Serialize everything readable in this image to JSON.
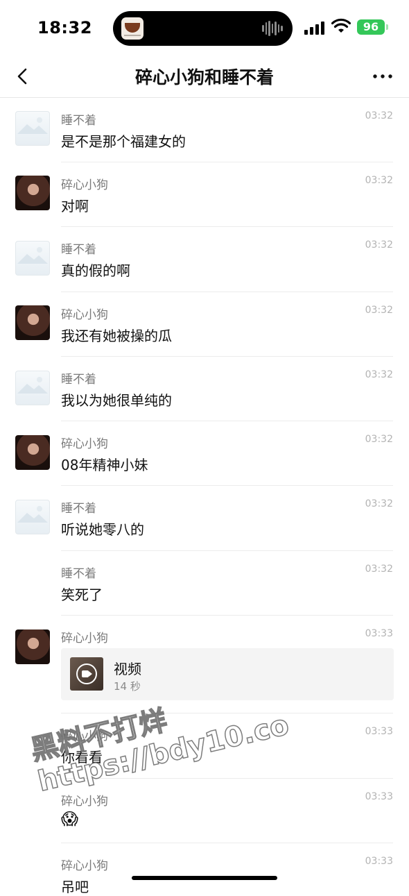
{
  "status_bar": {
    "time": "18:32",
    "battery": "96",
    "icons": [
      "signal-icon",
      "wifi-icon",
      "battery-icon",
      "waveform-icon"
    ]
  },
  "nav": {
    "title": "碎心小狗和睡不着",
    "back_icon": "chevron-left-icon",
    "more_icon": "ellipsis-icon"
  },
  "messages": [
    {
      "sender": "睡不着",
      "time": "03:32",
      "text": "是不是那个福建女的",
      "avatar": "placeholder"
    },
    {
      "sender": "碎心小狗",
      "time": "03:32",
      "text": "对啊",
      "avatar": "photo"
    },
    {
      "sender": "睡不着",
      "time": "03:32",
      "text": "真的假的啊",
      "avatar": "placeholder"
    },
    {
      "sender": "碎心小狗",
      "time": "03:32",
      "text": "我还有她被操的瓜",
      "avatar": "photo"
    },
    {
      "sender": "睡不着",
      "time": "03:32",
      "text": "我以为她很单纯的",
      "avatar": "placeholder"
    },
    {
      "sender": "碎心小狗",
      "time": "03:32",
      "text": "08年精神小妹",
      "avatar": "photo"
    },
    {
      "sender": "睡不着",
      "time": "03:32",
      "text": "听说她零八的",
      "avatar": "placeholder"
    },
    {
      "sender": "睡不着",
      "time": "03:32",
      "text": "笑死了",
      "avatar": "none"
    },
    {
      "sender": "碎心小狗",
      "time": "03:33",
      "video": {
        "title": "视频",
        "duration": "14 秒"
      },
      "avatar": "photo"
    },
    {
      "sender": "碎心小狗",
      "time": "03:33",
      "text": "你看看",
      "avatar": "none"
    },
    {
      "sender": "碎心小狗",
      "time": "03:33",
      "emoji": "😱",
      "avatar": "none"
    },
    {
      "sender": "碎心小狗",
      "time": "03:33",
      "text": "吊吧",
      "avatar": "none"
    }
  ],
  "watermark": {
    "line1": "黑料不打烊",
    "line2": "https://bdy10.co"
  }
}
